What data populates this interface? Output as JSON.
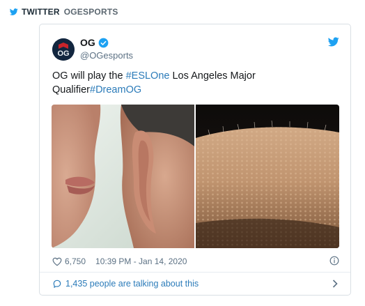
{
  "source": {
    "platform": "TWITTER",
    "account": "OGESPORTS"
  },
  "tweet": {
    "author_name": "OG",
    "author_handle": "@OGesports",
    "text_parts": [
      {
        "text": "OG will play the ",
        "type": "text"
      },
      {
        "text": "#ESLOne",
        "type": "hashtag"
      },
      {
        "text": " Los Angeles Major Qualifier",
        "type": "text"
      },
      {
        "text": "#DreamOG",
        "type": "hashtag"
      }
    ],
    "likes": "6,750",
    "timestamp": "10:39 PM - Jan 14, 2020",
    "conversation": "1,435 people are talking about this"
  },
  "icons": {
    "source_bird": "twitter-bird-icon",
    "verified": "verified-badge-icon",
    "logo": "twitter-logo-icon",
    "like": "heart-icon",
    "info": "info-icon",
    "comment": "speech-bubble-icon",
    "arrow": "chevron-right-icon"
  },
  "colors": {
    "twitter_blue": "#1da1f2",
    "link": "#2b7bb9",
    "muted": "#5b7083",
    "avatar_bg": "#12263f"
  }
}
